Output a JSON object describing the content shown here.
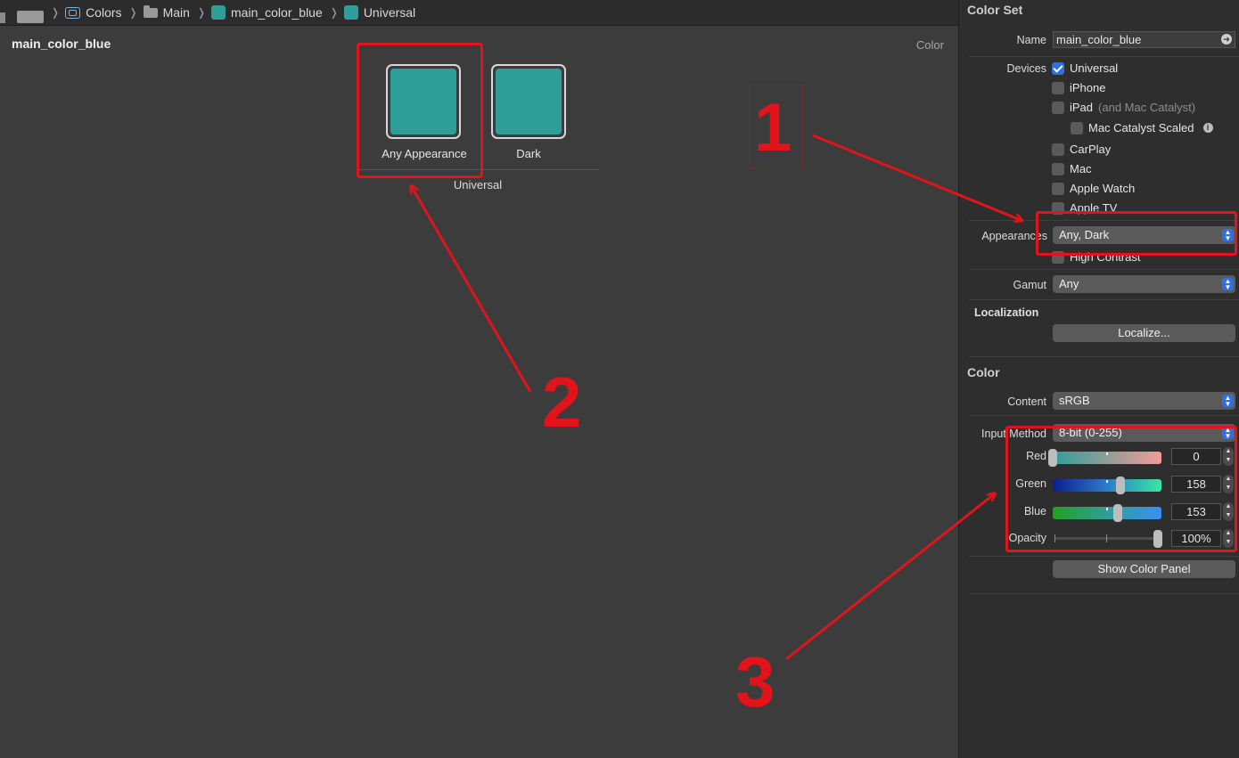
{
  "breadcrumb": {
    "items": [
      "Colors",
      "Main",
      "main_color_blue",
      "Universal"
    ]
  },
  "editor": {
    "asset_title": "main_color_blue",
    "type_label": "Color",
    "swatches": [
      {
        "label": "Any Appearance",
        "color": "#2e9f98"
      },
      {
        "label": "Dark",
        "color": "#2e9f98"
      }
    ],
    "group_label": "Universal"
  },
  "annotations": [
    "1",
    "2",
    "3"
  ],
  "inspector": {
    "color_set_header": "Color Set",
    "name_label": "Name",
    "name_value": "main_color_blue",
    "devices_label": "Devices",
    "devices": {
      "universal": "Universal",
      "iphone": "iPhone",
      "ipad": "iPad",
      "ipad_note": "(and Mac Catalyst)",
      "mac_catalyst_scaled": "Mac Catalyst Scaled",
      "carplay": "CarPlay",
      "mac": "Mac",
      "apple_watch": "Apple Watch",
      "apple_tv": "Apple TV"
    },
    "appearances_label": "Appearances",
    "appearances_value": "Any, Dark",
    "high_contrast": "High Contrast",
    "gamut_label": "Gamut",
    "gamut_value": "Any",
    "localization_header": "Localization",
    "localize_button": "Localize...",
    "color_header": "Color",
    "content_label": "Content",
    "content_value": "sRGB",
    "input_method_label": "Input Method",
    "input_method_value": "8-bit (0-255)",
    "sliders": {
      "red": {
        "label": "Red",
        "value": "0",
        "level": 0
      },
      "green": {
        "label": "Green",
        "value": "158",
        "level": 0.62
      },
      "blue": {
        "label": "Blue",
        "value": "153",
        "level": 0.6
      },
      "opacity": {
        "label": "Opacity",
        "value": "100%",
        "level": 1
      }
    },
    "show_color_panel": "Show Color Panel"
  },
  "colors": {
    "swatch": "#2e9f98",
    "accent": "#2f6fe0",
    "annotation": "#e0141a"
  }
}
